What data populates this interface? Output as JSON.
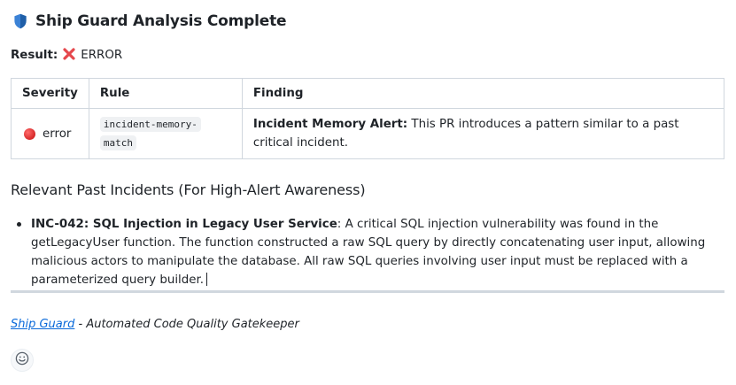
{
  "header": {
    "title": "Ship Guard Analysis Complete",
    "icon": "shield-icon"
  },
  "result": {
    "label": "Result:",
    "status_icon": "cross-mark-icon",
    "status_text": "ERROR"
  },
  "findings_table": {
    "columns": [
      "Severity",
      "Rule",
      "Finding"
    ],
    "rows": [
      {
        "severity": "error",
        "severity_icon": "red-circle-icon",
        "rule_line1": "incident-memory-",
        "rule_line2": "match",
        "finding_title": "Incident Memory Alert:",
        "finding_text": " This PR introduces a pattern similar to a past critical incident."
      }
    ]
  },
  "incidents": {
    "heading": "Relevant Past Incidents (For High-Alert Awareness)",
    "items": [
      {
        "title": "INC-042: SQL Injection in Legacy User Service",
        "colon": ":",
        "text": " A critical SQL injection vulnerability was found in the getLegacyUser function. The function constructed a raw SQL query by directly concatenating user input, allowing malicious actors to manipulate the database. All raw SQL queries involving user input must be replaced with a parameterized query builder."
      }
    ]
  },
  "footer": {
    "link_text": "Ship Guard",
    "tagline": " - Automated Code Quality Gatekeeper"
  },
  "reaction": {
    "icon": "smiley-icon"
  },
  "colors": {
    "accent_link": "#0969da",
    "error_red": "#e5484d",
    "border": "#d0d7de"
  }
}
